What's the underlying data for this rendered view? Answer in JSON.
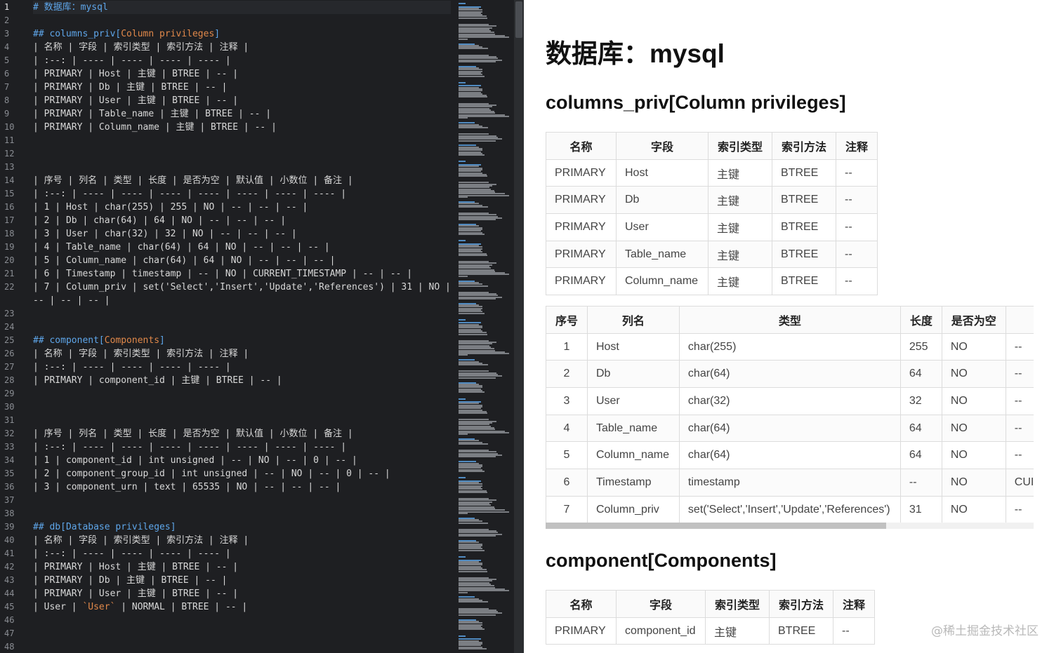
{
  "editor": {
    "active_line": 1,
    "lines": [
      {
        "n": "1",
        "text": "# 数据库：mysql",
        "style": "h"
      },
      {
        "n": "2",
        "text": ""
      },
      {
        "n": "3",
        "text": "## columns_priv[Column privileges]",
        "style": "h"
      },
      {
        "n": "4",
        "text": "| 名称 | 字段 | 索引类型 | 索引方法 | 注释 |"
      },
      {
        "n": "5",
        "text": "| :--: | ---- | ---- | ---- | ---- |"
      },
      {
        "n": "6",
        "text": "| PRIMARY | Host | 主键 | BTREE | -- |"
      },
      {
        "n": "7",
        "text": "| PRIMARY | Db | 主键 | BTREE | -- |"
      },
      {
        "n": "8",
        "text": "| PRIMARY | User | 主键 | BTREE | -- |"
      },
      {
        "n": "9",
        "text": "| PRIMARY | Table_name | 主键 | BTREE | -- |"
      },
      {
        "n": "10",
        "text": "| PRIMARY | Column_name | 主键 | BTREE | -- |"
      },
      {
        "n": "11",
        "text": ""
      },
      {
        "n": "12",
        "text": ""
      },
      {
        "n": "13",
        "text": ""
      },
      {
        "n": "14",
        "text": "| 序号 | 列名 | 类型 | 长度 | 是否为空 | 默认值 | 小数位 | 备注 |"
      },
      {
        "n": "15",
        "text": "| :--: | ---- | ---- | ---- | ---- | ---- | ---- | ---- |"
      },
      {
        "n": "16",
        "text": "| 1 | Host | char(255) | 255 | NO | -- | -- | -- |"
      },
      {
        "n": "17",
        "text": "| 2 | Db | char(64) | 64 | NO | -- | -- | -- |"
      },
      {
        "n": "18",
        "text": "| 3 | User | char(32) | 32 | NO | -- | -- | -- |"
      },
      {
        "n": "19",
        "text": "| 4 | Table_name | char(64) | 64 | NO | -- | -- | -- |"
      },
      {
        "n": "20",
        "text": "| 5 | Column_name | char(64) | 64 | NO | -- | -- | -- |"
      },
      {
        "n": "21",
        "text": "| 6 | Timestamp | timestamp | -- | NO | CURRENT_TIMESTAMP | -- | -- |"
      },
      {
        "n": "22",
        "text": "| 7 | Column_priv | set('Select','Insert','Update','References') | 31 | NO |"
      },
      {
        "n": "",
        "text": "-- | -- | -- |"
      },
      {
        "n": "23",
        "text": ""
      },
      {
        "n": "24",
        "text": ""
      },
      {
        "n": "25",
        "text": "## component[Components]",
        "style": "h"
      },
      {
        "n": "26",
        "text": "| 名称 | 字段 | 索引类型 | 索引方法 | 注释 |"
      },
      {
        "n": "27",
        "text": "| :--: | ---- | ---- | ---- | ---- |"
      },
      {
        "n": "28",
        "text": "| PRIMARY | component_id | 主键 | BTREE | -- |"
      },
      {
        "n": "29",
        "text": ""
      },
      {
        "n": "30",
        "text": ""
      },
      {
        "n": "31",
        "text": ""
      },
      {
        "n": "32",
        "text": "| 序号 | 列名 | 类型 | 长度 | 是否为空 | 默认值 | 小数位 | 备注 |"
      },
      {
        "n": "33",
        "text": "| :--: | ---- | ---- | ---- | ---- | ---- | ---- | ---- |"
      },
      {
        "n": "34",
        "text": "| 1 | component_id | int unsigned | -- | NO | -- | 0 | -- |"
      },
      {
        "n": "35",
        "text": "| 2 | component_group_id | int unsigned | -- | NO | -- | 0 | -- |"
      },
      {
        "n": "36",
        "text": "| 3 | component_urn | text | 65535 | NO | -- | -- | -- |"
      },
      {
        "n": "37",
        "text": ""
      },
      {
        "n": "38",
        "text": ""
      },
      {
        "n": "39",
        "text": "## db[Database privileges]",
        "style": "h"
      },
      {
        "n": "40",
        "text": "| 名称 | 字段 | 索引类型 | 索引方法 | 注释 |"
      },
      {
        "n": "41",
        "text": "| :--: | ---- | ---- | ---- | ---- |"
      },
      {
        "n": "42",
        "text": "| PRIMARY | Host | 主键 | BTREE | -- |"
      },
      {
        "n": "43",
        "text": "| PRIMARY | Db | 主键 | BTREE | -- |"
      },
      {
        "n": "44",
        "text": "| PRIMARY | User | 主键 | BTREE | -- |"
      },
      {
        "n": "45",
        "text": "| User | `User` | NORMAL | BTREE | -- |"
      },
      {
        "n": "46",
        "text": ""
      },
      {
        "n": "47",
        "text": ""
      },
      {
        "n": "48",
        "text": ""
      }
    ]
  },
  "preview": {
    "title": "数据库：mysql",
    "section1": {
      "heading": "columns_priv[Column privileges]",
      "index_table": {
        "headers": [
          "名称",
          "字段",
          "索引类型",
          "索引方法",
          "注释"
        ],
        "rows": [
          [
            "PRIMARY",
            "Host",
            "主键",
            "BTREE",
            "--"
          ],
          [
            "PRIMARY",
            "Db",
            "主键",
            "BTREE",
            "--"
          ],
          [
            "PRIMARY",
            "User",
            "主键",
            "BTREE",
            "--"
          ],
          [
            "PRIMARY",
            "Table_name",
            "主键",
            "BTREE",
            "--"
          ],
          [
            "PRIMARY",
            "Column_name",
            "主键",
            "BTREE",
            "--"
          ]
        ]
      },
      "column_table": {
        "headers": [
          "序号",
          "列名",
          "类型",
          "长度",
          "是否为空",
          ""
        ],
        "rows": [
          [
            "1",
            "Host",
            "char(255)",
            "255",
            "NO",
            "--"
          ],
          [
            "2",
            "Db",
            "char(64)",
            "64",
            "NO",
            "--"
          ],
          [
            "3",
            "User",
            "char(32)",
            "32",
            "NO",
            "--"
          ],
          [
            "4",
            "Table_name",
            "char(64)",
            "64",
            "NO",
            "--"
          ],
          [
            "5",
            "Column_name",
            "char(64)",
            "64",
            "NO",
            "--"
          ],
          [
            "6",
            "Timestamp",
            "timestamp",
            "--",
            "NO",
            "CUI"
          ],
          [
            "7",
            "Column_priv",
            "set('Select','Insert','Update','References')",
            "31",
            "NO",
            "--"
          ]
        ]
      }
    },
    "section2": {
      "heading": "component[Components]",
      "index_table": {
        "headers": [
          "名称",
          "字段",
          "索引类型",
          "索引方法",
          "注释"
        ],
        "rows": [
          [
            "PRIMARY",
            "component_id",
            "主键",
            "BTREE",
            "--"
          ]
        ]
      }
    },
    "watermark": "@稀土掘金技术社区"
  },
  "colors": {
    "editor_bg": "#1e1f22",
    "heading_blue": "#5ea6ea",
    "accent_orange": "#e0884a"
  }
}
